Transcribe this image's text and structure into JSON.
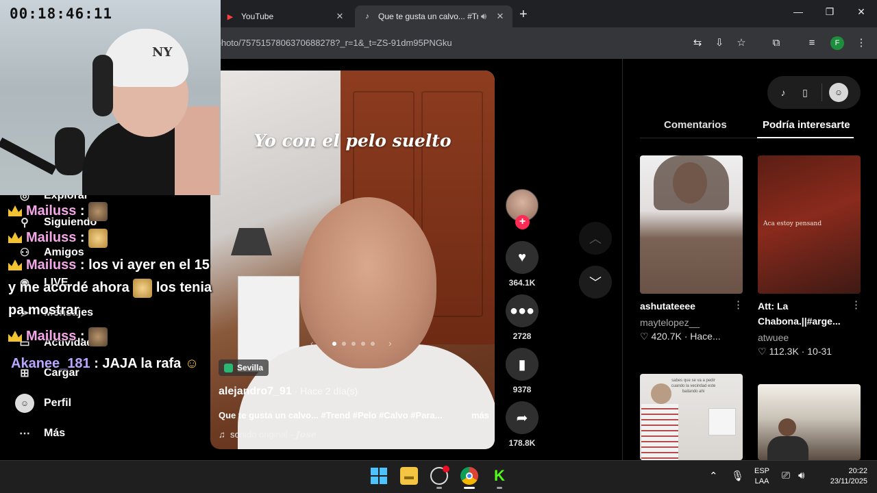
{
  "browser": {
    "tabs": [
      {
        "title": "YouTube",
        "active": false
      },
      {
        "title": "Que te gusta un calvo... #Tre",
        "active": true
      }
    ],
    "url": "/photo/7575157806370688278?_r=1&_t=ZS-91dm95PNGku"
  },
  "sidebar": {
    "items": [
      {
        "label": "Explorar",
        "icon": "compass-icon"
      },
      {
        "label": "Siguiendo",
        "icon": "user-follow-icon"
      },
      {
        "label": "Amigos",
        "icon": "friends-icon"
      },
      {
        "label": "LIVE",
        "icon": "live-icon"
      },
      {
        "label": "Mensajes",
        "icon": "send-icon"
      },
      {
        "label": "Actividad",
        "icon": "inbox-icon"
      },
      {
        "label": "Cargar",
        "icon": "upload-icon"
      },
      {
        "label": "Perfil",
        "icon": "avatar-icon"
      },
      {
        "label": "Más",
        "icon": "more-icon"
      }
    ]
  },
  "video": {
    "overlay_text": "Yo con el pelo suelto",
    "location": "Sevilla",
    "author": "alejandro7_91",
    "posted": " · Hace 2 día(s)",
    "caption": "Que te gusta un calvo... #Trend #Pelo #Calvo #Para...",
    "more_label": "más",
    "sound_label": "sonido original - ",
    "sound_artist": "Jose",
    "slide_count": 5,
    "slide_active": 1
  },
  "actions": {
    "likes": "364.1K",
    "comments": "2728",
    "saves": "9378",
    "shares": "178.8K"
  },
  "right_panel": {
    "tabs": [
      "Comentarios",
      "Podría interesarte"
    ],
    "active_tab": "Podría interesarte",
    "suggestions": [
      {
        "title": "ashutateeee",
        "user": "maytelopez__",
        "likes": "420.7K",
        "date": "Hace..."
      },
      {
        "title": "Att: La Chabona.||#arge...",
        "user": "atwuee",
        "likes": "112.3K",
        "date": "10-31",
        "thumb_text": "Aca estoy pensand"
      },
      {
        "thumb_text": "sabes que se va a pedir cuando la vecindad este bailando ahi"
      },
      {}
    ]
  },
  "stream": {
    "timer": "00:18:46:11",
    "chat": [
      {
        "user": "Mailuss",
        "text": " : "
      },
      {
        "user": "Mailuss",
        "text": " : "
      },
      {
        "user": "Mailuss",
        "text": " : los vi ayer en el 15"
      },
      {
        "text": "y me acordé ahora "
      },
      {
        "text": " los tenia"
      },
      {
        "text": "pa mostrar"
      },
      {
        "user": "Mailuss",
        "text": " : "
      },
      {
        "user": "Akanee_181",
        "text": " : JAJA la rafa"
      }
    ]
  },
  "taskbar": {
    "lang_top": "ESP",
    "lang_bottom": "LAA",
    "time": "20:22",
    "date": "23/11/2025"
  }
}
